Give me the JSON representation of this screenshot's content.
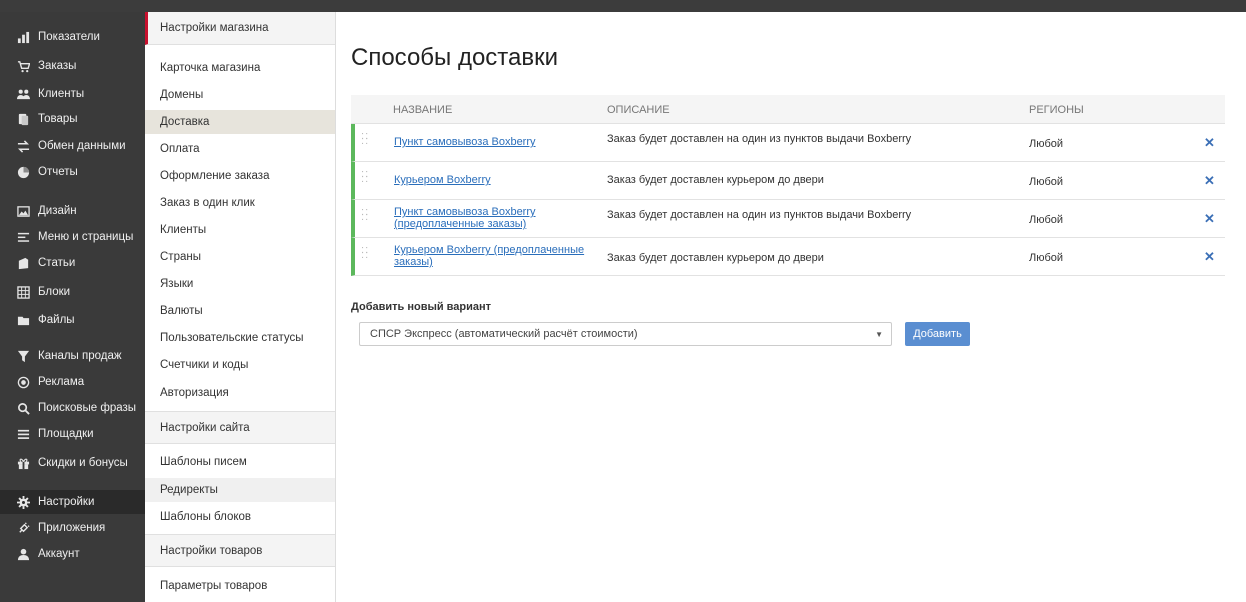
{
  "sidebar": {
    "items": [
      {
        "label": "Показатели",
        "icon": "bar-chart-icon"
      },
      {
        "label": "Заказы",
        "icon": "cart-icon"
      },
      {
        "label": "Клиенты",
        "icon": "users-icon"
      },
      {
        "label": "Товары",
        "icon": "products-icon"
      },
      {
        "label": "Обмен данными",
        "icon": "exchange-icon"
      },
      {
        "label": "Отчеты",
        "icon": "pie-chart-icon"
      },
      {
        "label": "Дизайн",
        "icon": "image-icon"
      },
      {
        "label": "Меню и страницы",
        "icon": "menu-icon"
      },
      {
        "label": "Статьи",
        "icon": "articles-icon"
      },
      {
        "label": "Блоки",
        "icon": "grid-icon"
      },
      {
        "label": "Файлы",
        "icon": "folder-icon"
      },
      {
        "label": "Каналы продаж",
        "icon": "filter-icon"
      },
      {
        "label": "Реклама",
        "icon": "target-icon"
      },
      {
        "label": "Поисковые фразы",
        "icon": "search-icon"
      },
      {
        "label": "Площадки",
        "icon": "list-icon"
      },
      {
        "label": "Скидки и бонусы",
        "icon": "gift-icon"
      },
      {
        "label": "Настройки",
        "icon": "gear-icon"
      },
      {
        "label": "Приложения",
        "icon": "plug-icon"
      },
      {
        "label": "Аккаунт",
        "icon": "user-icon"
      }
    ]
  },
  "submenu": {
    "header_store": "Настройки магазина",
    "store_items": [
      "Карточка магазина",
      "Домены",
      "Доставка",
      "Оплата",
      "Оформление заказа",
      "Заказ в один клик",
      "Клиенты",
      "Страны",
      "Языки",
      "Валюты",
      "Пользовательские статусы",
      "Счетчики и коды",
      "Авторизация"
    ],
    "header_site": "Настройки сайта",
    "site_items": [
      "Шаблоны писем",
      "Редиректы",
      "Шаблоны блоков"
    ],
    "header_products": "Настройки товаров",
    "product_items": [
      "Параметры товаров"
    ]
  },
  "main": {
    "title": "Способы доставки",
    "columns": {
      "name": "НАЗВАНИЕ",
      "description": "ОПИСАНИЕ",
      "regions": "РЕГИОНЫ"
    },
    "rows": [
      {
        "name": "Пункт самовывоза Boxberry",
        "description": "Заказ будет доставлен на один из пунктов выдачи Boxberry",
        "region": "Любой"
      },
      {
        "name": "Курьером Boxberry",
        "description": "Заказ будет доставлен курьером до двери",
        "region": "Любой"
      },
      {
        "name": "Пункт самовывоза Boxberry (предоплаченные заказы)",
        "description": "Заказ будет доставлен на один из пунктов выдачи Boxberry",
        "region": "Любой"
      },
      {
        "name": "Курьером Boxberry (предоплаченные заказы)",
        "description": "Заказ будет доставлен курьером до двери",
        "region": "Любой"
      }
    ],
    "delete_glyph": "✕",
    "add_label": "Добавить новый вариант",
    "select_value": "СПСР Экспресс (автоматический расчёт стоимости)",
    "add_button": "Добавить"
  },
  "colors": {
    "accent": "#c8102e",
    "row_marker": "#5cb85c",
    "link": "#2a6ebb",
    "button": "#5a8ed1"
  }
}
